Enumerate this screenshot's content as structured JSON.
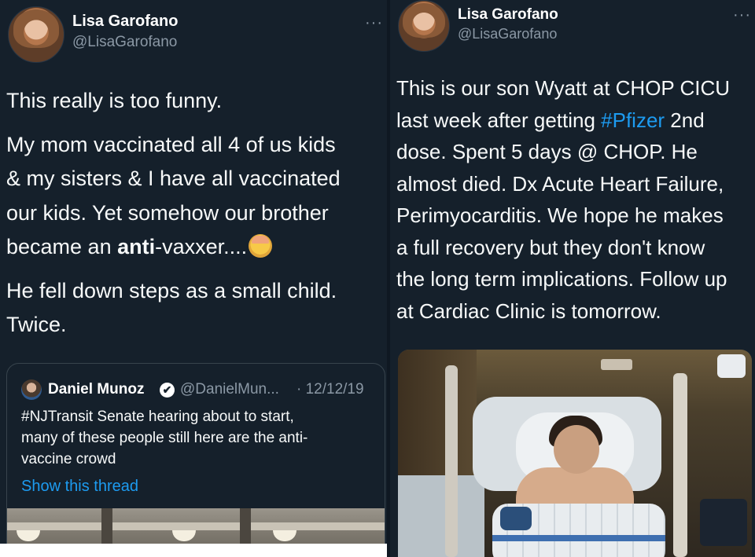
{
  "left_tweet": {
    "author": {
      "name": "Lisa Garofano",
      "handle": "@LisaGarofano"
    },
    "more_label": "···",
    "paragraphs": [
      {
        "lines": [
          "This really is too funny."
        ]
      },
      {
        "lines": [
          "My mom vaccinated all 4 of us kids",
          "& my sisters & I have all vaccinated",
          "our kids. Yet somehow our brother"
        ],
        "last_line": {
          "before": "became an ",
          "bold": "anti",
          "after": "-vaxxer....",
          "emoji": "face-palm"
        }
      },
      {
        "lines": [
          "He fell down steps as a small child.",
          "Twice."
        ]
      }
    ],
    "quoted": {
      "name": "Daniel Munoz",
      "verified_icon": "✔",
      "handle": "@DanielMun...",
      "date": "· 12/12/19",
      "text_lines": [
        "#NJTransit Senate hearing about to start,",
        "many of these people still here are the anti-",
        "vaccine crowd"
      ],
      "show_thread": "Show this thread",
      "media": "photo"
    }
  },
  "right_tweet": {
    "author": {
      "name": "Lisa Garofano",
      "handle": "@LisaGarofano"
    },
    "more_label": "···",
    "text_lines": [
      {
        "text": "This is our son Wyatt at CHOP CICU"
      },
      {
        "before": "last week after getting ",
        "hashtag": "#Pfizer",
        "after": " 2nd"
      },
      {
        "text": "dose. Spent 5 days @ CHOP. He"
      },
      {
        "text": "almost died. Dx Acute Heart Failure,"
      },
      {
        "text": "Perimyocarditis. We hope he makes"
      },
      {
        "text": "a full recovery but they don't know"
      },
      {
        "text": "the long term implications. Follow up"
      },
      {
        "text": "at Cardiac Clinic is tomorrow."
      }
    ],
    "media": "photo"
  },
  "colors": {
    "background": "#15202b",
    "text": "#f7f9f9",
    "secondary": "#8b98a5",
    "link": "#1d9bf0",
    "border": "#38444d"
  }
}
